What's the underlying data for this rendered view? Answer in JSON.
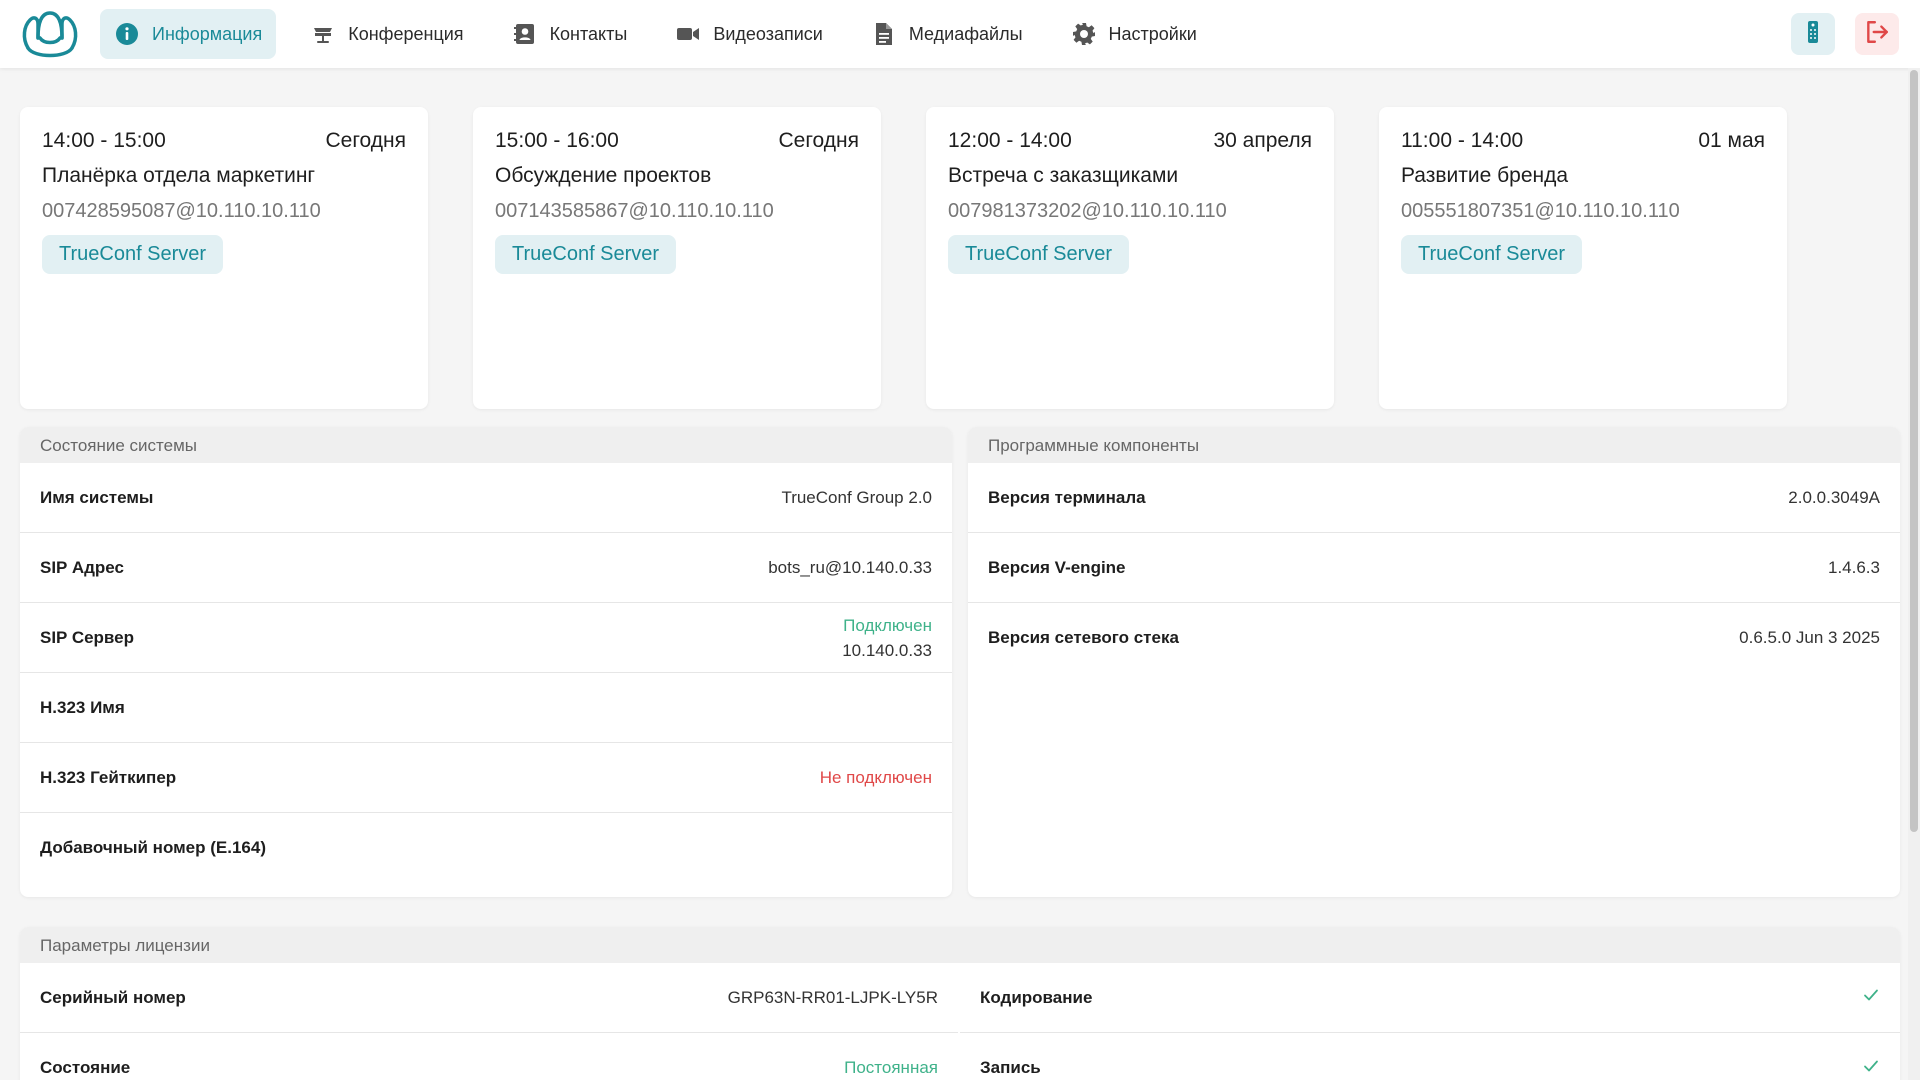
{
  "colors": {
    "accent": "#1a8a98",
    "accent_bg": "#e2f0f3",
    "danger": "#e04848",
    "success": "#3fb28a"
  },
  "nav": {
    "items": [
      {
        "label": "Информация",
        "icon": "info-icon",
        "active": true
      },
      {
        "label": "Конференция",
        "icon": "conference-icon"
      },
      {
        "label": "Контакты",
        "icon": "contacts-icon"
      },
      {
        "label": "Видеозаписи",
        "icon": "video-camera-icon"
      },
      {
        "label": "Медиафайлы",
        "icon": "document-icon"
      },
      {
        "label": "Настройки",
        "icon": "gear-icon"
      }
    ],
    "right_buttons": [
      "remote-control-icon",
      "logout-icon"
    ]
  },
  "conferences": [
    {
      "time": "14:00 - 15:00",
      "date": "Сегодня",
      "title": "Планёрка отдела маркетинг",
      "id": "007428595087@10.110.10.110",
      "server": "TrueConf Server"
    },
    {
      "time": "15:00 - 16:00",
      "date": "Сегодня",
      "title": "Обсуждение проектов",
      "id": "007143585867@10.110.10.110",
      "server": "TrueConf Server"
    },
    {
      "time": "12:00 - 14:00",
      "date": "30 апреля",
      "title": "Встреча с заказщиками",
      "id": "007981373202@10.110.10.110",
      "server": "TrueConf Server"
    },
    {
      "time": "11:00 - 14:00",
      "date": "01 мая",
      "title": "Развитие бренда",
      "id": "005551807351@10.110.10.110",
      "server": "TrueConf Server"
    }
  ],
  "system_state": {
    "header": "Состояние системы",
    "rows": [
      {
        "label": "Имя системы",
        "value": "TrueConf Group 2.0"
      },
      {
        "label": "SIP Адрес",
        "value": "bots_ru@10.140.0.33"
      },
      {
        "label": "SIP Сервер",
        "status": "Подключен",
        "value": "10.140.0.33"
      },
      {
        "label": "H.323 Имя",
        "value": ""
      },
      {
        "label": "H.323 Гейткипер",
        "value": "Не подключен"
      },
      {
        "label": "Добавочный номер (E.164)",
        "value": ""
      }
    ]
  },
  "software": {
    "header": "Программные компоненты",
    "rows": [
      {
        "label": "Версия терминала",
        "value": "2.0.0.3049A"
      },
      {
        "label": "Версия V-engine",
        "value": "1.4.6.3"
      },
      {
        "label": "Версия сетевого стека",
        "value": "0.6.5.0 Jun 3 2025"
      }
    ]
  },
  "license": {
    "header": "Параметры лицензии",
    "left_rows": [
      {
        "label": "Серийный номер",
        "value": "GRP63N-RR01-LJPK-LY5R"
      },
      {
        "label": "Состояние",
        "value": "Постоянная"
      }
    ],
    "right_rows": [
      {
        "label": "Кодирование",
        "enabled": true
      },
      {
        "label": "Запись",
        "enabled": true
      }
    ]
  }
}
